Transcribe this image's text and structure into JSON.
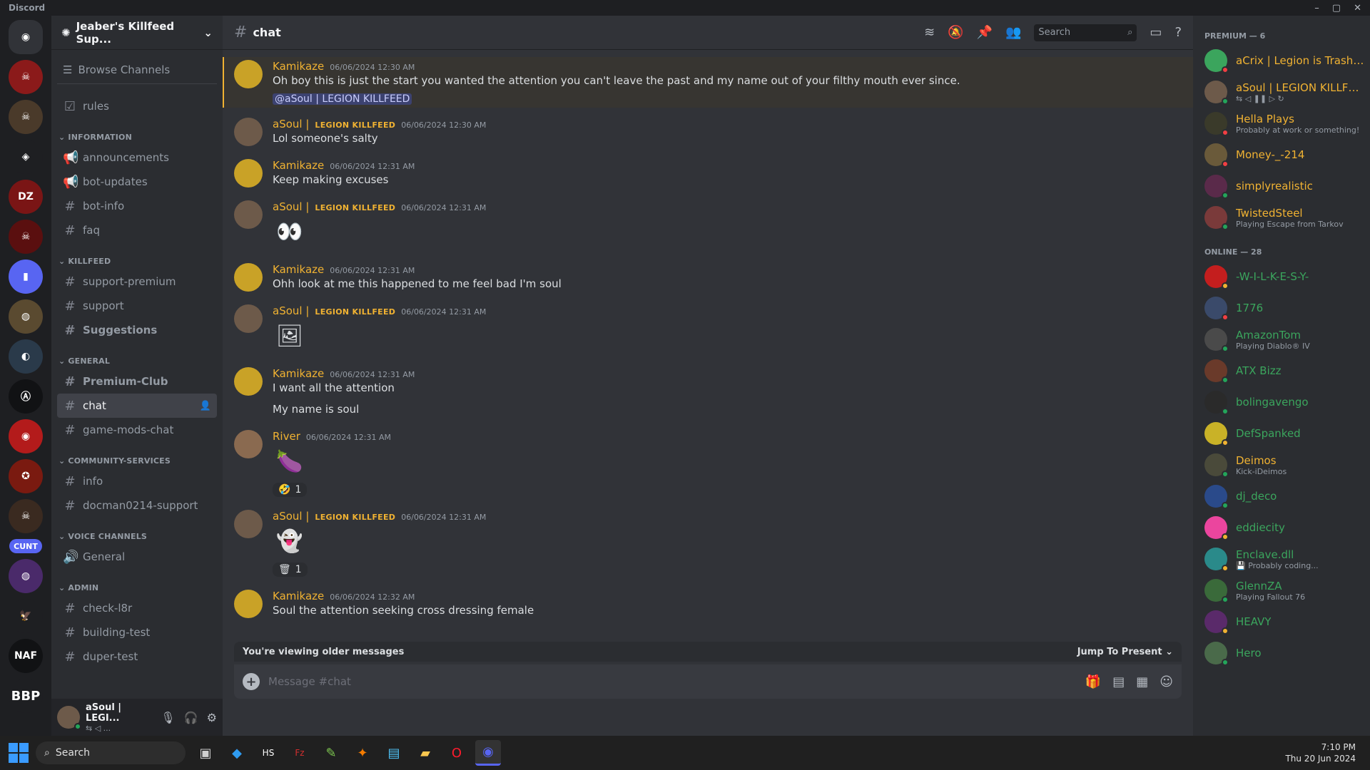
{
  "window": {
    "app_name": "Discord",
    "controls": [
      "–",
      "▢",
      "✕"
    ]
  },
  "servers": [
    {
      "label": "",
      "color": "#313338",
      "icon": "discord-home-icon",
      "glyph": "◉",
      "home": true
    },
    {
      "label": "",
      "color": "#8b1a1a",
      "glyph": "☠"
    },
    {
      "label": "",
      "color": "#4a3a2a",
      "glyph": "☠"
    },
    {
      "label": "",
      "color": "#1e1f22",
      "glyph": "◈"
    },
    {
      "label": "",
      "color": "#7a1515",
      "glyph": "DZ"
    },
    {
      "label": "",
      "color": "#5a0f0f",
      "glyph": "☠"
    },
    {
      "label": "",
      "color": "#5865f2",
      "glyph": "▮"
    },
    {
      "label": "",
      "color": "#5a4a30",
      "glyph": "◍"
    },
    {
      "label": "",
      "color": "#2a3a4a",
      "glyph": "◐"
    },
    {
      "label": "",
      "color": "#111214",
      "glyph": "Ⓐ"
    },
    {
      "label": "",
      "color": "#b31b1b",
      "glyph": "◉"
    },
    {
      "label": "",
      "color": "#7a1a10",
      "glyph": "✪"
    },
    {
      "label": "",
      "color": "#3a2a20",
      "glyph": "☠"
    },
    {
      "label": "CUNT",
      "color": "#5865f2",
      "pill": true
    },
    {
      "label": "",
      "color": "#4a2a6a",
      "glyph": "◍"
    },
    {
      "label": "",
      "color": "#1e1f22",
      "glyph": "🦅"
    },
    {
      "label": "",
      "color": "#111214",
      "glyph": "NAF"
    },
    {
      "label": "BBP",
      "color": "#1e1f22",
      "txt": true
    }
  ],
  "guild": {
    "name": "Jeaber's Killfeed Sup...",
    "browse_label": "Browse Channels"
  },
  "channel_sections": [
    {
      "category": "",
      "channels": [
        {
          "name": "rules",
          "icon": "rules-icon",
          "glyph": "☑"
        }
      ]
    },
    {
      "category": "INFORMATION",
      "channels": [
        {
          "name": "announcements",
          "icon": "announcement-icon",
          "glyph": "📢"
        },
        {
          "name": "bot-updates",
          "icon": "announcement-icon",
          "glyph": "📢"
        },
        {
          "name": "bot-info",
          "icon": "hash-icon",
          "glyph": "#"
        },
        {
          "name": "faq",
          "icon": "hash-icon",
          "glyph": "#"
        }
      ]
    },
    {
      "category": "KILLFEED",
      "channels": [
        {
          "name": "support-premium",
          "icon": "hash-icon",
          "glyph": "#"
        },
        {
          "name": "support",
          "icon": "hash-icon",
          "glyph": "#"
        },
        {
          "name": "Suggestions",
          "icon": "hash-icon",
          "glyph": "#",
          "bold": true
        }
      ]
    },
    {
      "category": "GENERAL",
      "channels": [
        {
          "name": "Premium-Club",
          "icon": "hash-icon",
          "glyph": "#",
          "bold": true
        },
        {
          "name": "chat",
          "icon": "hash-icon",
          "glyph": "#",
          "active": true
        },
        {
          "name": "game-mods-chat",
          "icon": "hash-icon",
          "glyph": "#"
        }
      ]
    },
    {
      "category": "COMMUNITY-SERVICES",
      "channels": [
        {
          "name": "info",
          "icon": "hash-icon",
          "glyph": "#"
        },
        {
          "name": "docman0214-support",
          "icon": "hash-icon",
          "glyph": "#"
        }
      ]
    },
    {
      "category": "VOICE CHANNELS",
      "channels": [
        {
          "name": "General",
          "icon": "speaker-icon",
          "glyph": "🔊"
        }
      ]
    },
    {
      "category": "ADMIN",
      "channels": [
        {
          "name": "check-l8r",
          "icon": "hash-icon",
          "glyph": "#"
        },
        {
          "name": "building-test",
          "icon": "hash-icon",
          "glyph": "#"
        },
        {
          "name": "duper-test",
          "icon": "hash-icon",
          "glyph": "#"
        }
      ]
    }
  ],
  "user_panel": {
    "name": "aSoul | LEGI...",
    "sub": "⇆   ◁  ..."
  },
  "topbar": {
    "channel": "chat",
    "search_placeholder": "Search"
  },
  "messages": [
    {
      "author": "Kamikaze",
      "color": "#f0b232",
      "tag": "",
      "time": "06/06/2024 12:30 AM",
      "lines": [
        "Oh boy this is just the start you wanted the attention you can't leave the past and my name out of your filthy mouth ever since."
      ],
      "mention": "@aSoul | LEGION KILLFEED",
      "highlight": true,
      "avatar": "#c9a227"
    },
    {
      "author": "aSoul |",
      "color": "#f0b232",
      "tag": "LEGION KILLFEED",
      "time": "06/06/2024 12:30 AM",
      "lines": [
        "Lol someone's salty"
      ],
      "avatar": "#6d5a4a"
    },
    {
      "author": "Kamikaze",
      "color": "#f0b232",
      "tag": "",
      "time": "06/06/2024 12:31 AM",
      "lines": [
        "Keep making excuses"
      ],
      "avatar": "#c9a227"
    },
    {
      "author": "aSoul |",
      "color": "#f0b232",
      "tag": "LEGION KILLFEED",
      "time": "06/06/2024 12:31 AM",
      "lines": [],
      "sticker": "👀",
      "avatar": "#6d5a4a"
    },
    {
      "author": "Kamikaze",
      "color": "#f0b232",
      "tag": "",
      "time": "06/06/2024 12:31 AM",
      "lines": [
        "Ohh look at me this happened to me feel bad I'm soul"
      ],
      "avatar": "#c9a227"
    },
    {
      "author": "aSoul |",
      "color": "#f0b232",
      "tag": "LEGION KILLFEED",
      "time": "06/06/2024 12:31 AM",
      "lines": [],
      "sticker": "🖼",
      "avatar": "#6d5a4a"
    },
    {
      "author": "Kamikaze",
      "color": "#f0b232",
      "tag": "",
      "time": "06/06/2024 12:31 AM",
      "lines": [
        "I want all the attention",
        "My name is soul"
      ],
      "avatar": "#c9a227"
    },
    {
      "author": "River",
      "color": "#f0b232",
      "tag": "",
      "time": "06/06/2024 12:31 AM",
      "lines": [],
      "sticker": "🍆",
      "reaction": {
        "emoji": "🤣",
        "count": "1"
      },
      "avatar": "#8a6a50"
    },
    {
      "author": "aSoul |",
      "color": "#f0b232",
      "tag": "LEGION KILLFEED",
      "time": "06/06/2024 12:31 AM",
      "lines": [],
      "sticker": "👻",
      "reaction": {
        "emoji": "🗑",
        "count": "1"
      },
      "avatar": "#6d5a4a"
    },
    {
      "author": "Kamikaze",
      "color": "#f0b232",
      "tag": "",
      "time": "06/06/2024 12:32 AM",
      "lines": [
        "Soul the attention seeking cross dressing female"
      ],
      "avatar": "#c9a227"
    }
  ],
  "older_bar": {
    "text": "You're viewing older messages",
    "jump": "Jump To Present"
  },
  "composer": {
    "placeholder": "Message #chat"
  },
  "member_groups": [
    {
      "title": "PREMIUM — 6",
      "members": [
        {
          "name": "aCrix | Legion is Trash 🗑",
          "activity": "",
          "color": "#f0b232",
          "avatar": "#3ba55d",
          "status": "#f23f43"
        },
        {
          "name": "aSoul | LEGION KILLFEED",
          "activity": "⇆   ◁   ❚❚   ▷   ↻",
          "color": "#f0b232",
          "avatar": "#6d5a4a",
          "status": "#23a55a"
        },
        {
          "name": "Hella Plays",
          "activity": "Probably at work or something!",
          "color": "#f0b232",
          "avatar": "#3a3a2a",
          "status": "#f23f43"
        },
        {
          "name": "Money-_-214",
          "activity": "",
          "color": "#f0b232",
          "avatar": "#6a5a3a",
          "status": "#f23f43"
        },
        {
          "name": "simplyrealistic",
          "activity": "",
          "color": "#f0b232",
          "avatar": "#5a2a4a",
          "status": "#23a55a"
        },
        {
          "name": "TwistedSteel",
          "activity": "Playing Escape from Tarkov",
          "color": "#f0b232",
          "avatar": "#7a3a3a",
          "status": "#23a55a"
        }
      ]
    },
    {
      "title": "ONLINE — 28",
      "members": [
        {
          "name": "-W-I-L-K-E-S-Y-",
          "activity": "",
          "color": "#3ba55d",
          "avatar": "#c41e1e",
          "status": "#f0b232"
        },
        {
          "name": "1776",
          "activity": "",
          "color": "#3ba55d",
          "avatar": "#3a4a6a",
          "status": "#f23f43"
        },
        {
          "name": "AmazonTom",
          "activity": "Playing Diablo® IV",
          "color": "#3ba55d",
          "avatar": "#4a4a4a",
          "status": "#23a55a"
        },
        {
          "name": "ATX Bizz",
          "activity": "",
          "color": "#3ba55d",
          "avatar": "#6a3a2a",
          "status": "#23a55a"
        },
        {
          "name": "bolingavengo",
          "activity": "",
          "color": "#3ba55d",
          "avatar": "#2a2a2a",
          "status": "#23a55a"
        },
        {
          "name": "DefSpanked",
          "activity": "",
          "color": "#3ba55d",
          "avatar": "#c9b227",
          "status": "#f0b232"
        },
        {
          "name": "Deimos",
          "activity": "Kick-iDeimos",
          "color": "#f0b232",
          "avatar": "#4a4a3a",
          "status": "#23a55a"
        },
        {
          "name": "dj_deco",
          "activity": "",
          "color": "#3ba55d",
          "avatar": "#2a4a8a",
          "status": "#23a55a"
        },
        {
          "name": "eddiecity",
          "activity": "",
          "color": "#3ba55d",
          "avatar": "#eb459e",
          "status": "#f0b232"
        },
        {
          "name": "Enclave.dll",
          "activity": "💾 Probably coding...",
          "color": "#3ba55d",
          "avatar": "#2a8a8a",
          "status": "#f0b232"
        },
        {
          "name": "GlennZA",
          "activity": "Playing Fallout 76",
          "color": "#3ba55d",
          "avatar": "#3a6a3a",
          "status": "#23a55a"
        },
        {
          "name": "HEAVY",
          "activity": "",
          "color": "#3ba55d",
          "avatar": "#5a2a6a",
          "status": "#f0b232"
        },
        {
          "name": "Hero",
          "activity": "",
          "color": "#3ba55d",
          "avatar": "#4a6a4a",
          "status": "#23a55a"
        }
      ]
    }
  ],
  "taskbar": {
    "search": "Search",
    "apps": [
      {
        "name": "task-view-icon",
        "glyph": "▣",
        "color": "#cfcfcf"
      },
      {
        "name": "vscode-icon",
        "glyph": "◆",
        "color": "#2f9bf0"
      },
      {
        "name": "hs-icon",
        "glyph": "HS",
        "color": "#fff"
      },
      {
        "name": "filezilla-icon",
        "glyph": "Fz",
        "color": "#d32f2f"
      },
      {
        "name": "notepadpp-icon",
        "glyph": "✎",
        "color": "#7ec850"
      },
      {
        "name": "app-icon",
        "glyph": "✦",
        "color": "#f57c00"
      },
      {
        "name": "notepad-icon",
        "glyph": "▤",
        "color": "#4fc3f7"
      },
      {
        "name": "file-explorer-icon",
        "glyph": "▰",
        "color": "#f9c74f"
      },
      {
        "name": "opera-icon",
        "glyph": "O",
        "color": "#ff1b2d"
      },
      {
        "name": "discord-icon",
        "glyph": "◉",
        "color": "#5865f2",
        "active": true
      }
    ],
    "time": "7:10 PM",
    "date": "Thu 20 Jun 2024"
  }
}
